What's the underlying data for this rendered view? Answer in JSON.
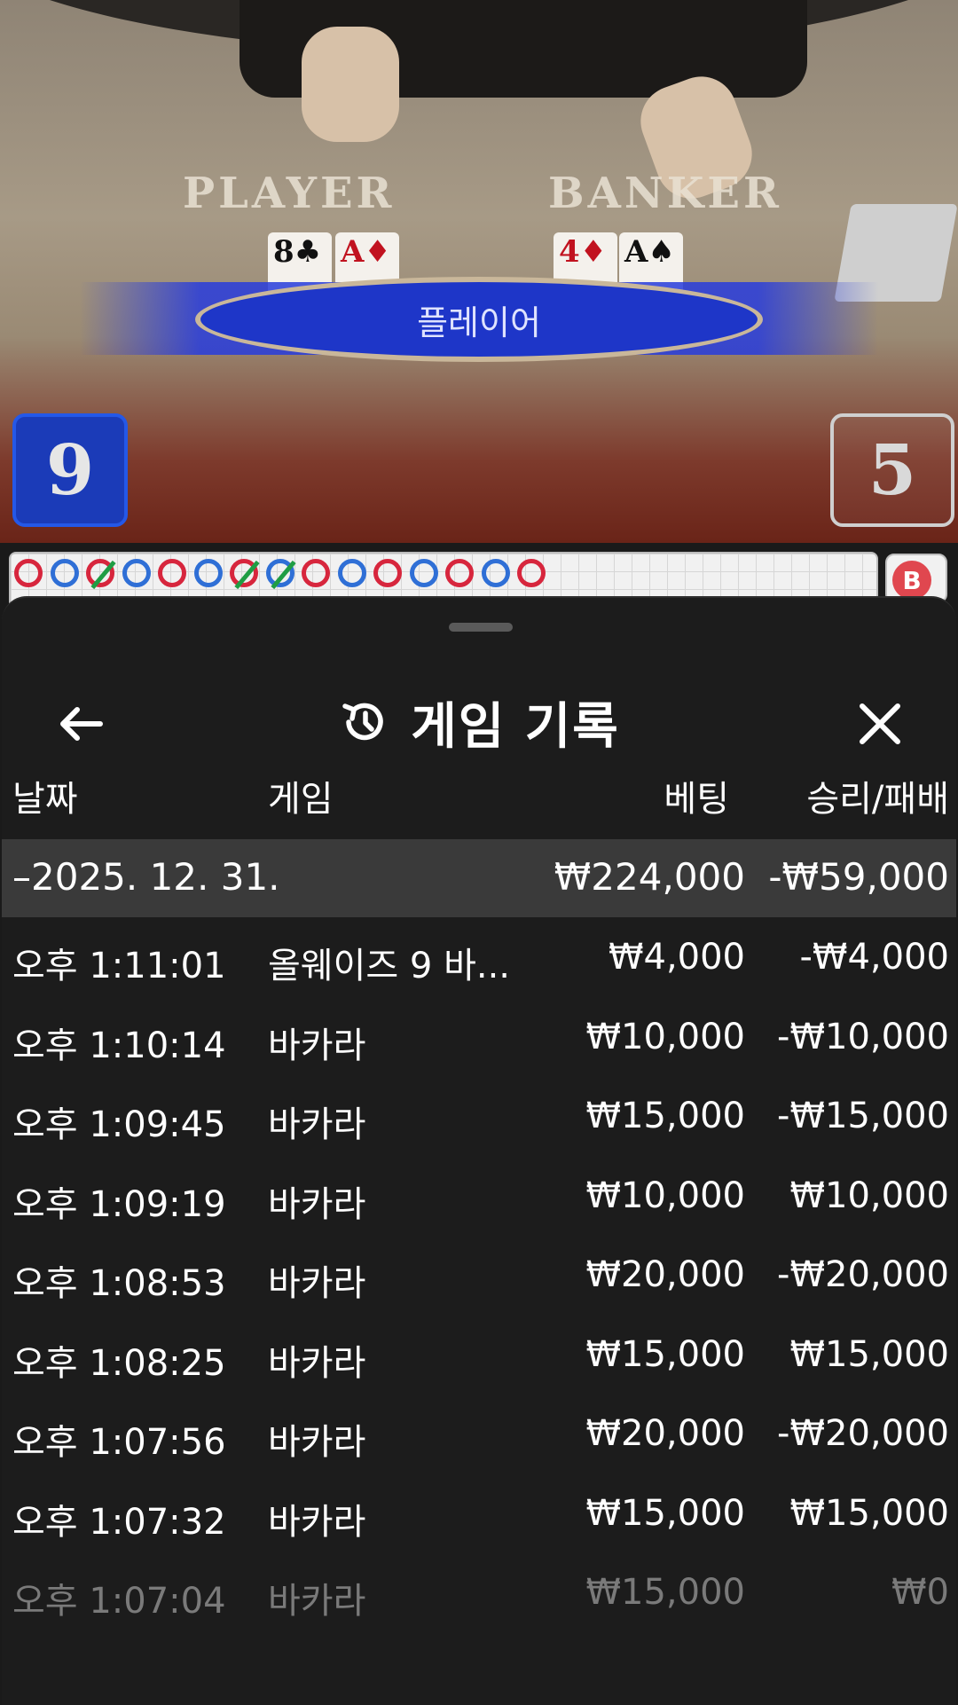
{
  "table": {
    "player_label": "PLAYER",
    "banker_label": "BANKER",
    "player_cards": [
      {
        "rank": "8",
        "suit": "♣",
        "color": "black"
      },
      {
        "rank": "A",
        "suit": "♦",
        "color": "red"
      }
    ],
    "banker_cards": [
      {
        "rank": "4",
        "suit": "♦",
        "color": "red"
      },
      {
        "rank": "A",
        "suit": "♠",
        "color": "black"
      }
    ],
    "winner_text": "플레이어",
    "player_score": "9",
    "banker_score": "5"
  },
  "bead_road": {
    "beads": [
      {
        "color": "red",
        "slash": false
      },
      {
        "color": "blue",
        "slash": false
      },
      {
        "color": "red",
        "slash": true
      },
      {
        "color": "blue",
        "slash": false
      },
      {
        "color": "red",
        "slash": false
      },
      {
        "color": "blue",
        "slash": false
      },
      {
        "color": "red",
        "slash": true
      },
      {
        "color": "blue",
        "slash": true
      },
      {
        "color": "red",
        "slash": false
      },
      {
        "color": "blue",
        "slash": false
      },
      {
        "color": "red",
        "slash": false
      },
      {
        "color": "blue",
        "slash": false
      },
      {
        "color": "red",
        "slash": false
      },
      {
        "color": "blue",
        "slash": false
      },
      {
        "color": "red",
        "slash": false
      }
    ],
    "next_label": "B"
  },
  "sheet": {
    "title": "게임 기록",
    "columns": {
      "date": "날짜",
      "game": "게임",
      "bet": "베팅",
      "win_loss": "승리/패배"
    },
    "summary": {
      "date": "–2025. 12. 31.",
      "bet": "₩224,000",
      "win_loss": "-₩59,000"
    },
    "rows": [
      {
        "time": "오후 1:11:01",
        "game": "올웨이즈 9 바...",
        "bet": "₩4,000",
        "win_loss": "-₩4,000"
      },
      {
        "time": "오후 1:10:14",
        "game": "바카라",
        "bet": "₩10,000",
        "win_loss": "-₩10,000"
      },
      {
        "time": "오후 1:09:45",
        "game": "바카라",
        "bet": "₩15,000",
        "win_loss": "-₩15,000"
      },
      {
        "time": "오후 1:09:19",
        "game": "바카라",
        "bet": "₩10,000",
        "win_loss": "₩10,000"
      },
      {
        "time": "오후 1:08:53",
        "game": "바카라",
        "bet": "₩20,000",
        "win_loss": "-₩20,000"
      },
      {
        "time": "오후 1:08:25",
        "game": "바카라",
        "bet": "₩15,000",
        "win_loss": "₩15,000"
      },
      {
        "time": "오후 1:07:56",
        "game": "바카라",
        "bet": "₩20,000",
        "win_loss": "-₩20,000"
      },
      {
        "time": "오후 1:07:32",
        "game": "바카라",
        "bet": "₩15,000",
        "win_loss": "₩15,000"
      },
      {
        "time": "오후 1:07:04",
        "game": "바카라",
        "bet": "₩15,000",
        "win_loss": "₩0"
      }
    ]
  },
  "colors": {
    "sheet_bg": "#1c1c1c",
    "summary_bg": "#3a3a3a",
    "player_blue": "#1b3bb8",
    "bead_red": "#d7263d",
    "bead_blue": "#2f6fd6"
  },
  "icons": {
    "back": "arrow-left-icon",
    "history": "history-clock-icon",
    "close": "close-icon"
  }
}
